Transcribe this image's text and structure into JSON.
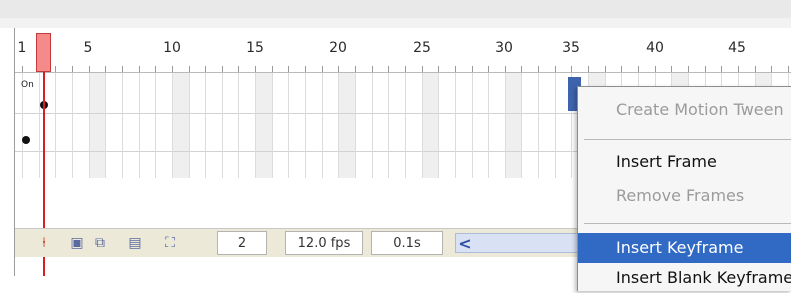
{
  "ruler": {
    "first_frame": "1",
    "labels": [
      "5",
      "10",
      "15",
      "20",
      "25",
      "30",
      "35",
      "40",
      "45"
    ]
  },
  "layers": {
    "onion_label": "On"
  },
  "status_bar": {
    "current_frame": "2",
    "frame_rate": "12.0 fps",
    "elapsed_time": "0.1s"
  },
  "context_menu": {
    "items": [
      {
        "label": "Create Motion Tween",
        "enabled": false
      },
      {
        "label": "Insert Frame",
        "enabled": true
      },
      {
        "label": "Remove Frames",
        "enabled": false
      },
      {
        "label": "Insert Keyframe",
        "enabled": true,
        "highlighted": true
      },
      {
        "label": "Insert Blank Keyframe",
        "enabled": true
      }
    ]
  },
  "icons": [
    "playhead-marker-icon",
    "center-frame-icon",
    "onion-skin-icon",
    "onion-skin-outlines-icon",
    "edit-multiple-frames-icon",
    "modify-onion-markers-icon",
    "scroll-left-arrow-icon"
  ],
  "colors": {
    "playhead": "#d81e1e",
    "playhead_fill": "#f48a8a",
    "menu_highlight": "#316ac5",
    "status_bar": "#ece9d8",
    "selected_frame": "#3e63ad"
  }
}
